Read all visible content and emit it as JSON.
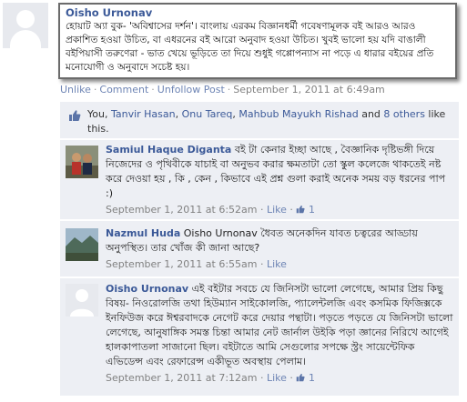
{
  "post": {
    "author": "Oisho Urnonav",
    "text": "হোয়াট অ্যা বুক- 'অবিশ্বাসের দর্শন'। বাংলায় এরকম বিজ্ঞানধর্মী গবেষণামূলক বই আরও আরও প্রকাশিত হওয়া উচিত, বা এধরনের বই আরো অনুবাদ হওয়া উচিত। খুবই ভালো হয় যদি বাঙালী বইপিয়াসী তরুণেরা - ভাত খেয়ে ভূড়িতে তা দিয়ে শুধুই গপ্পোপন্যাস না পড়ে এ ধারার বইয়ের প্রতি মনোযোগী ও অনুবাদে সচেষ্ট হয়।",
    "actions": {
      "unlike": "Unlike",
      "comment": "Comment",
      "unfollow": "Unfollow Post",
      "timestamp": "September 1, 2011 at 6:49am"
    }
  },
  "likes": {
    "prefix": "You, ",
    "people": [
      "Tanvir Hasan",
      "Onu Tareq",
      "Mahbub Mayukh Rishad"
    ],
    "and": " and ",
    "others": "8 others",
    "suffix": " like this."
  },
  "comments": [
    {
      "author": "Samiul Haque Diganta",
      "text": "বই টা কেনার ইচ্ছা আছে , বৈজ্ঞানিক দৃষ্টিভঙ্গী দিয়ে নিজেদের ও পৃথিবীকে যাচাই বা অনুভব করার ক্ষমতাটা তো স্কুল কলেজে থাকতেই নষ্ট করে দেওয়া হয় , কি , কেন , কিভাবে এই প্রশ্ন গুলা করাই অনেক সময় বড় ধরনের পাপ :)",
      "timestamp": "September 1, 2011 at 6:52am",
      "like_label": "Like",
      "like_count": "1"
    },
    {
      "author": "Nazmul Huda",
      "text": "Oisho Urnonav ধৈবত অনেকদিন যাবত চত্বরের আড্ডায় অনুপস্থিত। তার খোঁজ কী জানা আছে?",
      "timestamp": "September 1, 2011 at 6:55am",
      "like_label": "Like",
      "like_count": ""
    },
    {
      "author": "Oisho Urnonav",
      "text": "এই বইটার সবচে যে জিনিসটা ভালো লেগেছে, আমার প্রিয় কিছু বিষয়- নিওরোলজি তথা হিউম্যান সাইকোলজি, প্যালেন্টলজি এবং কসমিক ফিজিক্সকে ইনফিউজ করে ঈশ্বরবাদকে নেগেট করে দেয়ার পন্থাটা। পড়তে পড়তে যে জিনিসটা ভালো লেগেছে, আনুষাঙ্গিক সমস্ত চিন্তা আমার নেট জার্নাল উইকি পড়া জ্ঞানের নিরিখে আগেই হালকাপাতলা সাজানো ছিল। বইটাতে আমি সেগুলোর সপক্ষে স্ট্রং সায়েন্টেফিক এভিডেন্স এবং রেফারেন্স একীভূত অবস্থায় পেলাম।",
      "timestamp": "September 1, 2011 at 7:12am",
      "like_label": "Like",
      "like_count": "1"
    }
  ],
  "colors": {
    "link": "#3b5998",
    "action": "#6d84b4",
    "panel": "#edeff4"
  }
}
